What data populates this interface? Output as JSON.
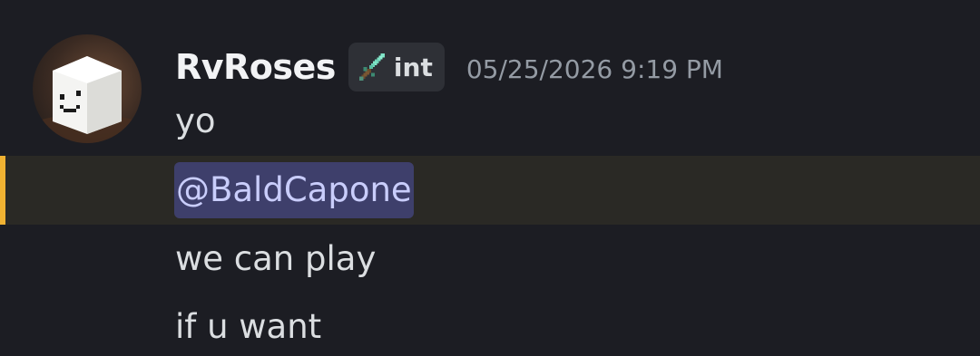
{
  "message": {
    "author": "RvRoses",
    "tag": {
      "icon": "sword-icon",
      "label": "int"
    },
    "timestamp": "05/25/2026 9:19 PM",
    "lines": [
      "yo",
      "@BaldCapone",
      "we can play",
      "if u want"
    ],
    "mention_highlight_color": "#f0b232",
    "mention_color": "#c9cdfb"
  }
}
